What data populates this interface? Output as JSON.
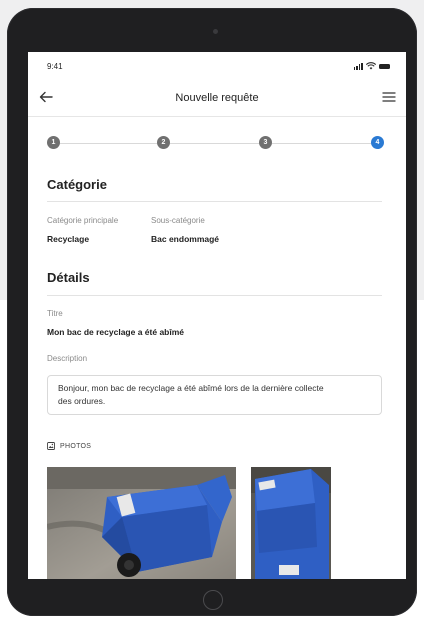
{
  "status_bar": {
    "time": "9:41"
  },
  "header": {
    "title": "Nouvelle requête"
  },
  "stepper": {
    "steps": [
      "1",
      "2",
      "3",
      "4"
    ],
    "active_step": 4
  },
  "categorie": {
    "title": "Catégorie",
    "principale_label": "Catégorie principale",
    "principale_value": "Recyclage",
    "sous_label": "Sous-catégorie",
    "sous_value": "Bac endommagé"
  },
  "details": {
    "title": "Détails",
    "titre_label": "Titre",
    "titre_value": "Mon bac de recyclage a été abîmé",
    "description_label": "Description",
    "description_line1": "Bonjour, mon bac de recyclage a été abîmé lors de la dernière collecte",
    "description_line2": "des ordures."
  },
  "photos": {
    "label": "PHOTOS"
  },
  "colors": {
    "accent": "#2a7ad3",
    "step_inactive": "#707070",
    "bin_blue": "#2f5fc4"
  }
}
